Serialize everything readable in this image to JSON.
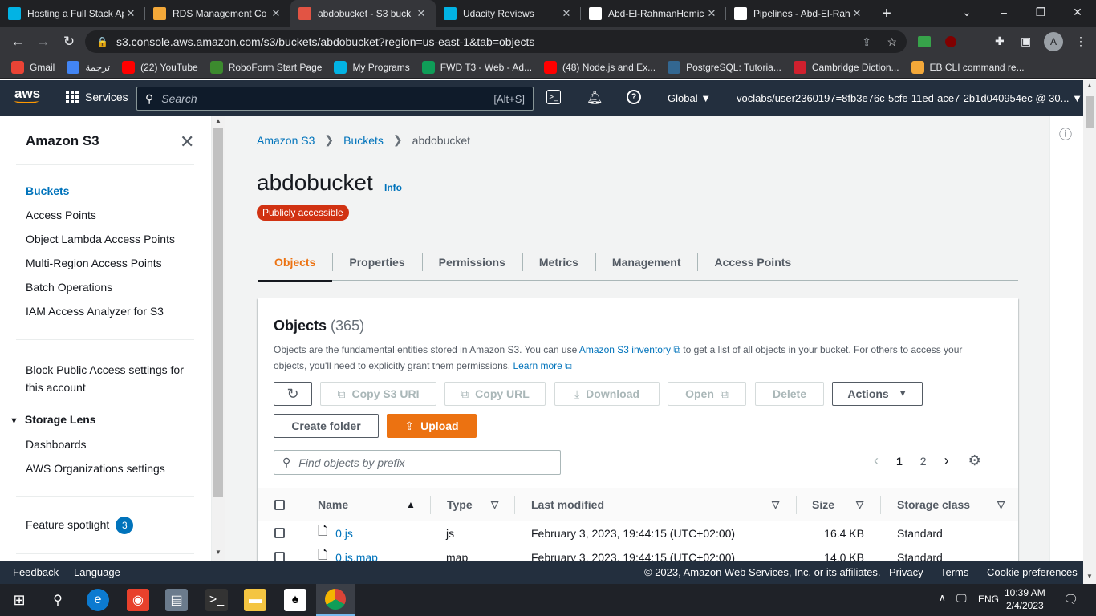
{
  "browser": {
    "tabs": [
      {
        "title": "Hosting a Full Stack Ap",
        "icon": "udacity-icon",
        "color": "#02b3e4"
      },
      {
        "title": "RDS Management Co",
        "icon": "rds-icon",
        "color": "#f3a839"
      },
      {
        "title": "abdobucket - S3 buck",
        "icon": "s3-icon",
        "color": "#e25444",
        "active": true
      },
      {
        "title": "Udacity Reviews",
        "icon": "udacity-icon",
        "color": "#02b3e4"
      },
      {
        "title": "Abd-El-RahmanHemic",
        "icon": "github-icon",
        "color": "#ffffff"
      },
      {
        "title": "Pipelines - Abd-El-Rah",
        "icon": "circleci-icon",
        "color": "#ffffff"
      }
    ],
    "url": "s3.console.aws.amazon.com/s3/buckets/abdobucket?region=us-east-1&tab=objects",
    "profile_initial": "A",
    "bookmarks": [
      {
        "label": "Gmail",
        "icon": "gmail-icon",
        "color": "#ea4335"
      },
      {
        "label": "ترجمة",
        "icon": "translate-icon",
        "color": "#4285f4"
      },
      {
        "label": "(22) YouTube",
        "icon": "youtube-icon",
        "color": "#ff0000"
      },
      {
        "label": "RoboForm Start Page",
        "icon": "roboform-icon",
        "color": "#3c8a2e"
      },
      {
        "label": "My Programs",
        "icon": "udacity-icon",
        "color": "#02b3e4"
      },
      {
        "label": "FWD T3 - Web - Ad...",
        "icon": "sheets-icon",
        "color": "#0f9d58"
      },
      {
        "label": "(48) Node.js and Ex...",
        "icon": "youtube-icon",
        "color": "#ff0000"
      },
      {
        "label": "PostgreSQL: Tutoria...",
        "icon": "postgres-icon",
        "color": "#336791"
      },
      {
        "label": "Cambridge Diction...",
        "icon": "cambridge-icon",
        "color": "#d0202e"
      },
      {
        "label": "EB CLI command re...",
        "icon": "aws-icon",
        "color": "#f3a839"
      }
    ]
  },
  "aws": {
    "logo": "aws",
    "services_label": "Services",
    "search_placeholder": "Search",
    "search_hint": "[Alt+S]",
    "region": "Global",
    "account": "voclabs/user2360197=8fb3e76c-5cfe-11ed-ace7-2b1d040954ec @ 30..."
  },
  "sidebar": {
    "title": "Amazon S3",
    "items": [
      {
        "label": "Buckets",
        "active": true
      },
      {
        "label": "Access Points"
      },
      {
        "label": "Object Lambda Access Points"
      },
      {
        "label": "Multi-Region Access Points"
      },
      {
        "label": "Batch Operations"
      },
      {
        "label": "IAM Access Analyzer for S3"
      }
    ],
    "block_public_line1": "Block Public Access settings for",
    "block_public_line2": "this account",
    "storage_lens": "Storage Lens",
    "storage_lens_items": [
      "Dashboards",
      "AWS Organizations settings"
    ],
    "feature_spotlight": "Feature spotlight",
    "feature_count": "3"
  },
  "main": {
    "breadcrumb": [
      "Amazon S3",
      "Buckets",
      "abdobucket"
    ],
    "title": "abdobucket",
    "info": "Info",
    "public_badge": "Publicly accessible",
    "tabs": [
      "Objects",
      "Properties",
      "Permissions",
      "Metrics",
      "Management",
      "Access Points"
    ],
    "objects": {
      "heading": "Objects",
      "count": "(365)",
      "desc_a": "Objects are the fundamental entities stored in Amazon S3. You can use ",
      "desc_link1": "Amazon S3 inventory",
      "desc_b": " to get a list of all objects in your bucket. For others to access your objects, you'll need to explicitly grant them permissions. ",
      "desc_link2": "Learn more",
      "buttons": {
        "copy_uri": "Copy S3 URI",
        "copy_url": "Copy URL",
        "download": "Download",
        "open": "Open",
        "delete": "Delete",
        "actions": "Actions",
        "create_folder": "Create folder",
        "upload": "Upload"
      },
      "filter_placeholder": "Find objects by prefix",
      "pages": [
        "1",
        "2"
      ],
      "columns": [
        "Name",
        "Type",
        "Last modified",
        "Size",
        "Storage class"
      ],
      "rows": [
        {
          "name": "0.js",
          "type": "js",
          "modified": "February 3, 2023, 19:44:15 (UTC+02:00)",
          "size": "16.4 KB",
          "class": "Standard"
        },
        {
          "name": "0.js.map",
          "type": "map",
          "modified": "February 3, 2023, 19:44:15 (UTC+02:00)",
          "size": "14.0 KB",
          "class": "Standard"
        }
      ]
    }
  },
  "footer": {
    "feedback": "Feedback",
    "language": "Language",
    "copyright": "© 2023, Amazon Web Services, Inc. or its affiliates.",
    "privacy": "Privacy",
    "terms": "Terms",
    "cookies": "Cookie preferences"
  },
  "taskbar": {
    "lang": "ENG",
    "time": "10:39 AM",
    "date": "2/4/2023"
  }
}
